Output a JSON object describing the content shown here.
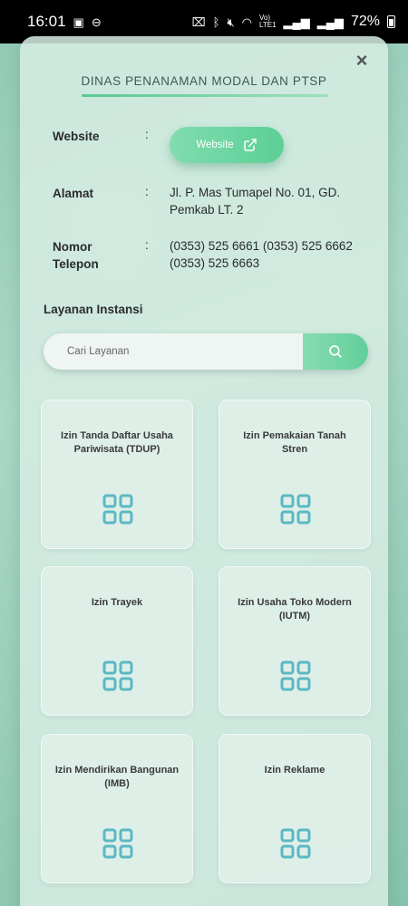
{
  "status_bar": {
    "time": "16:01",
    "battery": "72%",
    "icons": [
      "image-icon",
      "dnd-icon",
      "nfc-icon",
      "bluetooth-icon",
      "mute-icon",
      "wifi-icon",
      "volte-icon",
      "signal-icon",
      "signal-icon",
      "battery-icon"
    ]
  },
  "modal": {
    "close_label": "×",
    "title": "DINAS PENANAMAN MODAL DAN PTSP"
  },
  "info": {
    "website_label": "Website",
    "website_button": "Website",
    "address_label": "Alamat",
    "address_value": "Jl. P. Mas Tumapel No. 01, GD. Pemkab LT. 2",
    "phone_label_1": "Nomor",
    "phone_label_2": "Telepon",
    "phone_value": "(0353) 525 6661 (0353) 525 6662 (0353) 525 6663",
    "colon": ":"
  },
  "services": {
    "section_title": "Layanan Instansi",
    "search_placeholder": "Cari Layanan",
    "items": [
      {
        "name": "Izin Tanda Daftar Usaha Pariwisata (TDUP)"
      },
      {
        "name": "Izin Pemakaian Tanah Stren"
      },
      {
        "name": "Izin Trayek"
      },
      {
        "name": "Izin Usaha Toko Modern (IUTM)"
      },
      {
        "name": "Izin Mendirikan Bangunan (IMB)"
      },
      {
        "name": "Izin Reklame"
      }
    ]
  },
  "colors": {
    "accent": "#5ccf96",
    "icon_teal": "#5bb8c4",
    "text": "#2b2b2b"
  }
}
